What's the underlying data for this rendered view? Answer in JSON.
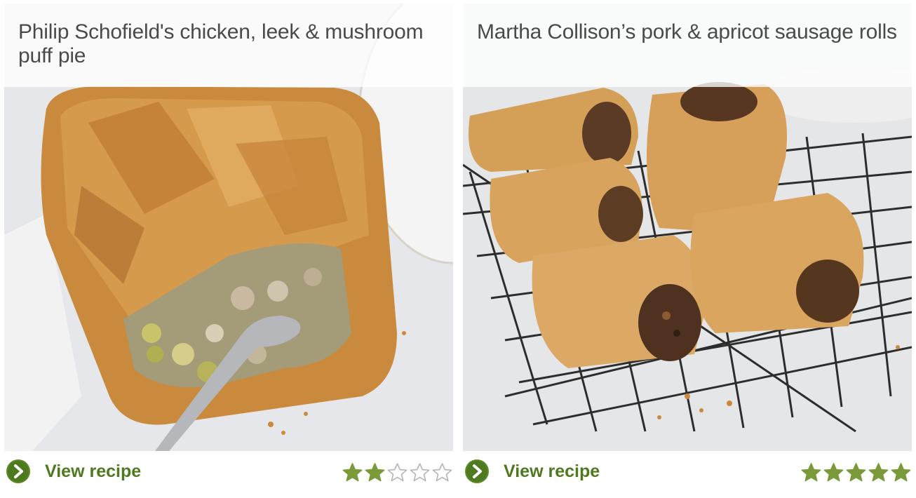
{
  "recipes": [
    {
      "title": "Philip Schofield's chicken, leek & mushroom puff pie",
      "link_label": "View recipe",
      "rating": 2,
      "max_rating": 5
    },
    {
      "title": "Martha Collison’s pork & apricot sausage rolls",
      "link_label": "View recipe",
      "rating": 5,
      "max_rating": 5
    }
  ],
  "colors": {
    "accent_green": "#4e7a1f",
    "arrow_green": "#5e8a25",
    "star_filled": "#7a9a3a",
    "star_empty_outline": "#b5b5b5"
  },
  "icons": {
    "link_icon": "chevron-right-circle-icon",
    "rating_icon": "star-icon"
  }
}
